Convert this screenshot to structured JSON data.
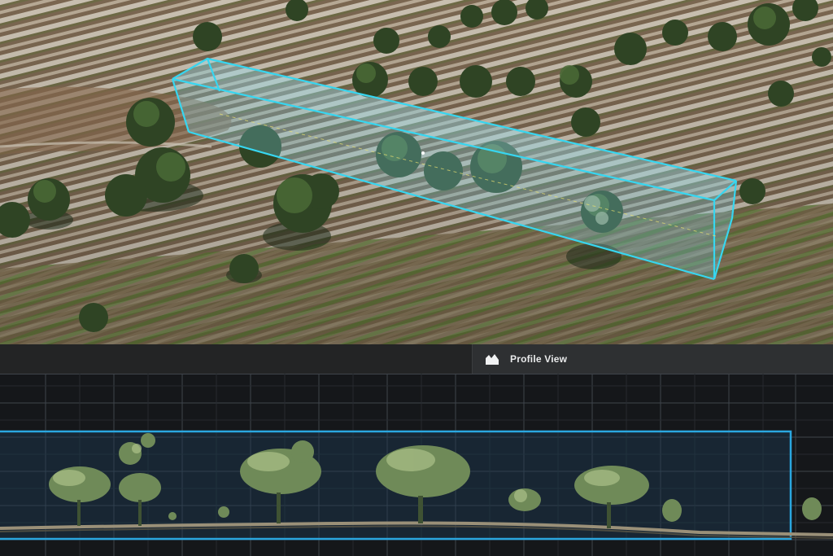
{
  "profile_panel": {
    "tab_label": "Profile View",
    "tab_icon": "terrain-profile-icon"
  },
  "colors": {
    "selection_box": "#37d6f0",
    "profile_box": "#2aa7e0",
    "profile_background": "#15171a",
    "grid": "#4a5058"
  }
}
